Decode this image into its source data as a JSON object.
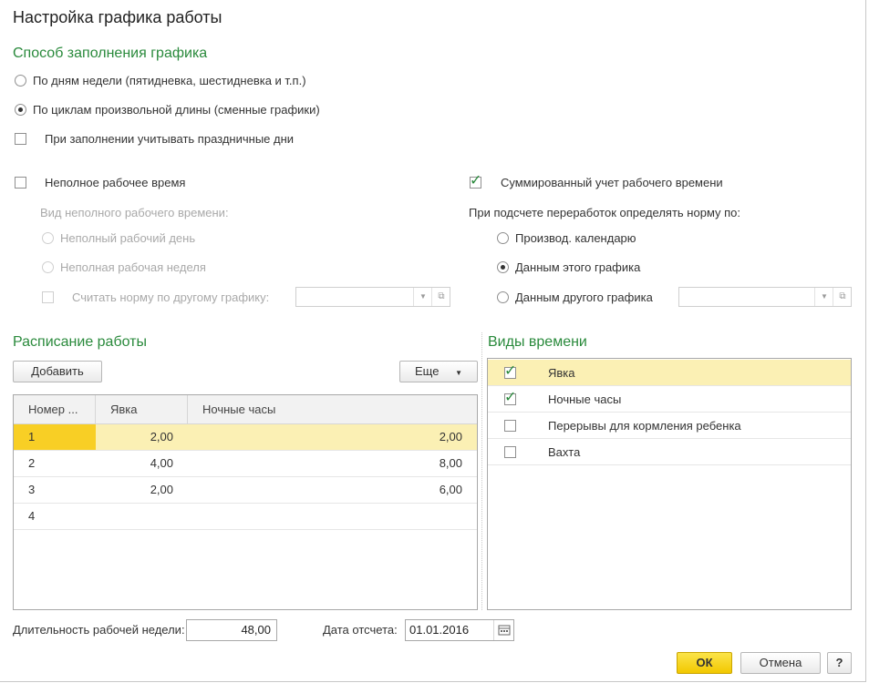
{
  "window": {
    "title": "Настройка графика работы"
  },
  "fill_method": {
    "heading": "Способ заполнения графика",
    "option_weekdays": "По дням недели (пятидневка, шестидневка и т.п.)",
    "option_cycles": "По циклам произвольной длины (сменные графики)",
    "selected": "cycles",
    "holidays_label": "При заполнении учитывать праздничные дни",
    "holidays_checked": false
  },
  "part_time": {
    "label": "Неполное рабочее время",
    "checked": false,
    "kind_label": "Вид неполного рабочего времени:",
    "option_day": "Неполный рабочий день",
    "option_week": "Неполная рабочая неделя",
    "other_schedule_label": "Считать норму по другому графику:",
    "other_schedule_value": ""
  },
  "summary": {
    "label": "Суммированный учет рабочего времени",
    "checked": true,
    "norm_label": "При подсчете переработок определять норму по:",
    "option_calendar": "Производ. календарю",
    "option_this": "Данным этого графика",
    "option_other": "Данным другого графика",
    "selected": "this",
    "other_value": ""
  },
  "schedule": {
    "heading": "Расписание работы",
    "add_button": "Добавить",
    "more_button": "Еще",
    "columns": [
      "Номер ...",
      "Явка",
      "Ночные часы"
    ],
    "rows": [
      {
        "num": "1",
        "yavka": "2,00",
        "night": "2,00",
        "selected": true
      },
      {
        "num": "2",
        "yavka": "4,00",
        "night": "8,00",
        "selected": false
      },
      {
        "num": "3",
        "yavka": "2,00",
        "night": "6,00",
        "selected": false
      },
      {
        "num": "4",
        "yavka": "",
        "night": "",
        "selected": false
      }
    ]
  },
  "time_types": {
    "heading": "Виды времени",
    "items": [
      {
        "label": "Явка",
        "checked": true,
        "selected": true
      },
      {
        "label": "Ночные часы",
        "checked": true,
        "selected": false
      },
      {
        "label": "Перерывы для кормления ребенка",
        "checked": false,
        "selected": false
      },
      {
        "label": "Вахта",
        "checked": false,
        "selected": false
      }
    ]
  },
  "footer": {
    "week_duration_label": "Длительность рабочей недели:",
    "week_duration_value": "48,00",
    "ref_date_label": "Дата отсчета:",
    "ref_date_value": "01.01.2016",
    "ok_button": "ОК",
    "cancel_button": "Отмена",
    "help_button": "?"
  },
  "colors": {
    "accent_green": "#2a8a3c",
    "selection_yellow": "#f8cf25",
    "row_highlight": "#fbf0b4"
  },
  "icons": [
    "radio",
    "checkbox",
    "check-mark-icon",
    "dropdown-arrow-icon",
    "open-form-icon",
    "calendar-icon",
    "more-menu-arrow-icon"
  ]
}
